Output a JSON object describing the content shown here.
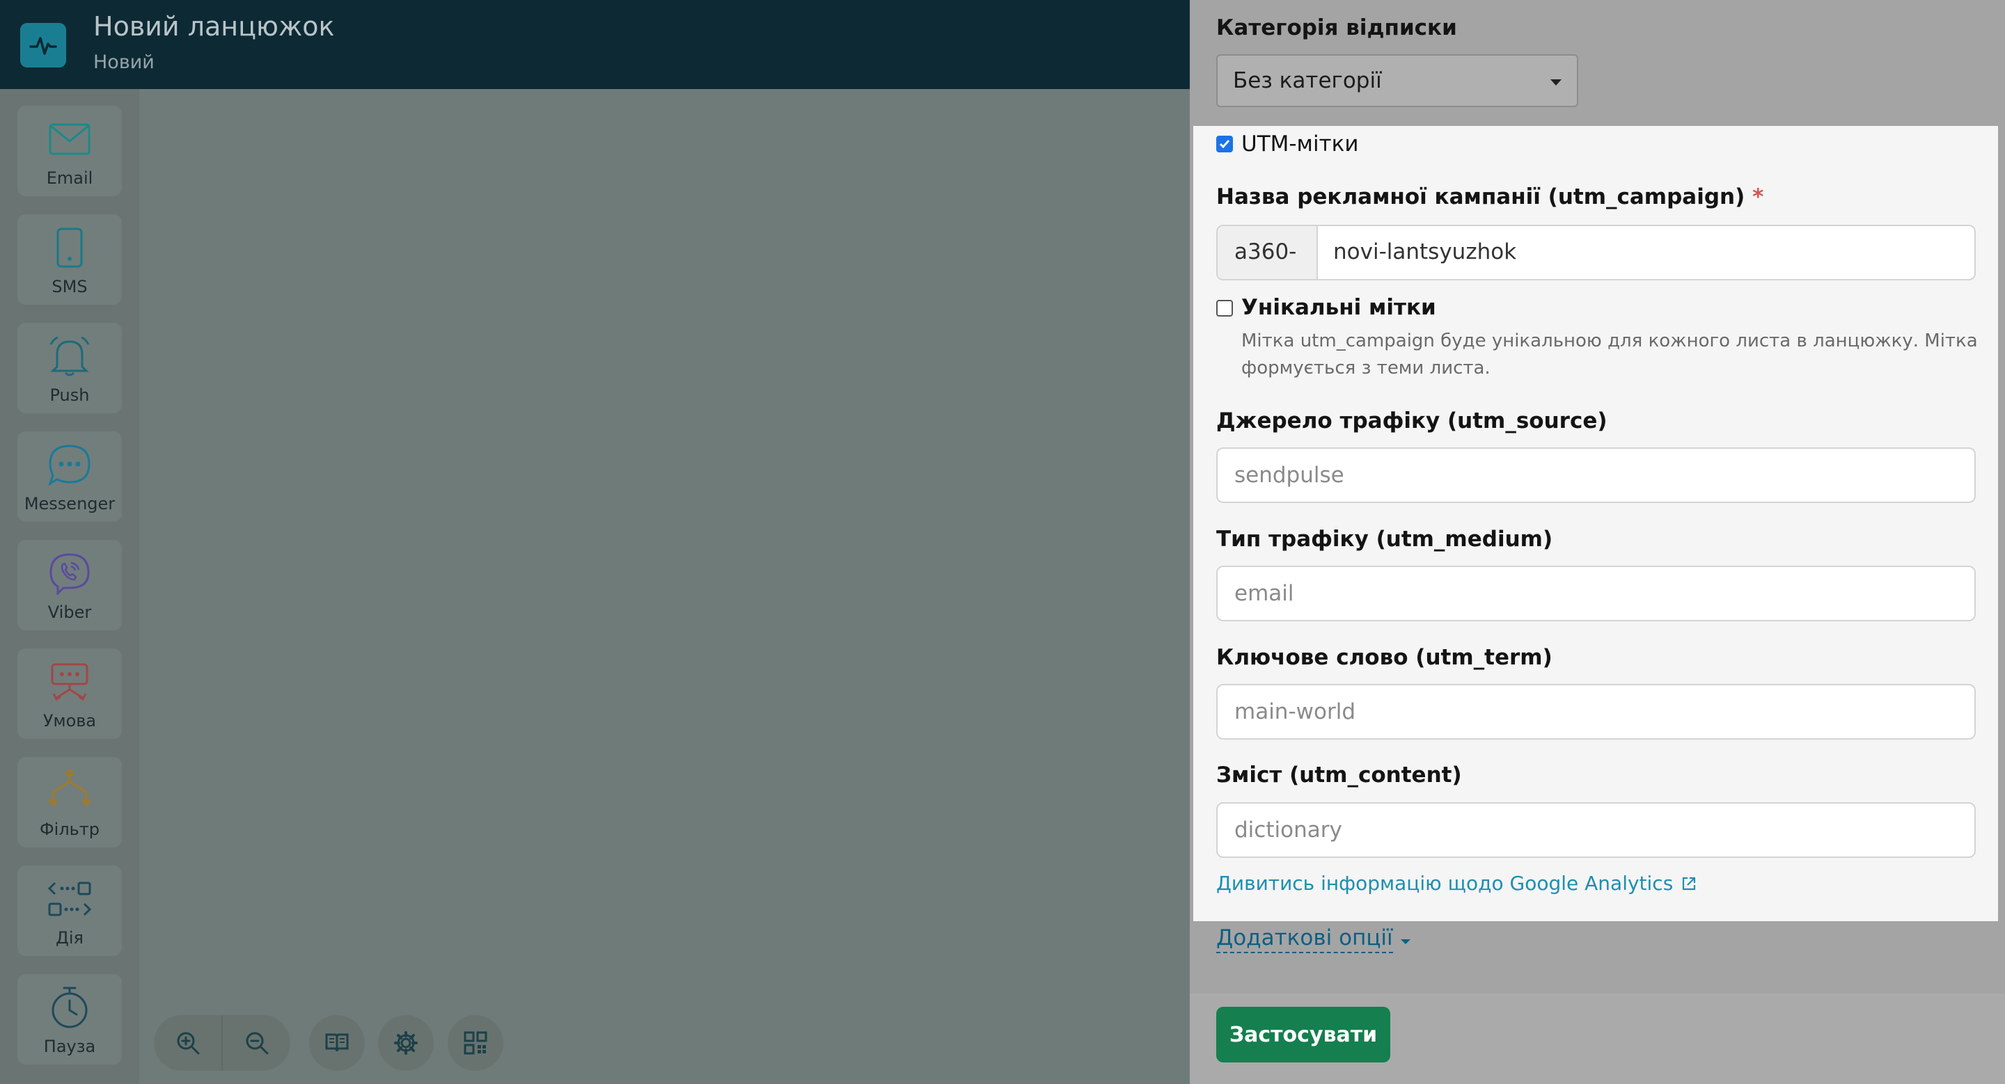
{
  "header": {
    "title": "Новий ланцюжок",
    "subtitle": "Новий"
  },
  "sidebar": {
    "items": [
      {
        "label": "Email",
        "icon": "envelope-icon",
        "color": "#1a8a8a"
      },
      {
        "label": "SMS",
        "icon": "phone-icon",
        "color": "#1a7a8a"
      },
      {
        "label": "Push",
        "icon": "bell-icon",
        "color": "#1d6a7a"
      },
      {
        "label": "Messenger",
        "icon": "chat-bubble-icon",
        "color": "#1a7a9a"
      },
      {
        "label": "Viber",
        "icon": "viber-icon",
        "color": "#5a4aa0"
      },
      {
        "label": "Умова",
        "icon": "condition-icon",
        "color": "#a04848"
      },
      {
        "label": "Фільтр",
        "icon": "filter-branch-icon",
        "color": "#a07a2a"
      },
      {
        "label": "Дія",
        "icon": "action-icon",
        "color": "#1d4a5a"
      },
      {
        "label": "Пауза",
        "icon": "stopwatch-icon",
        "color": "#1d4a5a"
      }
    ]
  },
  "canvas_controls": {
    "zoom_in": "zoom-in-icon",
    "zoom_out": "zoom-out-icon",
    "guide": "book-icon",
    "settings": "gear-icon",
    "qr": "qr-code-icon"
  },
  "panel": {
    "unsubscribe_category_label": "Категорія відписки",
    "unsubscribe_category_value": "Без категорії",
    "utm_checkbox_label": "UTM-мітки",
    "utm_checked": true,
    "campaign_label": "Назва рекламної кампанії (utm_campaign)",
    "campaign_required": "*",
    "campaign_prefix": "a360-",
    "campaign_value": "novi-lantsyuzhok",
    "unique_label": "Унікальні мітки",
    "unique_checked": false,
    "unique_help_line1": "Мітка utm_campaign буде унікальною для кожного листа в ланцюжку. Мітка",
    "unique_help_line2": "формується з теми листа.",
    "source_label": "Джерело трафіку (utm_source)",
    "source_placeholder": "sendpulse",
    "medium_label": "Тип трафіку (utm_medium)",
    "medium_placeholder": "email",
    "term_label": "Ключове слово (utm_term)",
    "term_placeholder": "main-world",
    "content_label": "Зміст (utm_content)",
    "content_placeholder": "dictionary",
    "ga_link": "Дивитись інформацію щодо Google Analytics",
    "more_options": "Додаткові опції",
    "apply": "Застосувати"
  },
  "colors": {
    "header_bg": "#0d2a34",
    "accent_green": "#157f4f",
    "link_blue": "#1d8fb0",
    "checkbox_blue": "#1a73e8"
  }
}
